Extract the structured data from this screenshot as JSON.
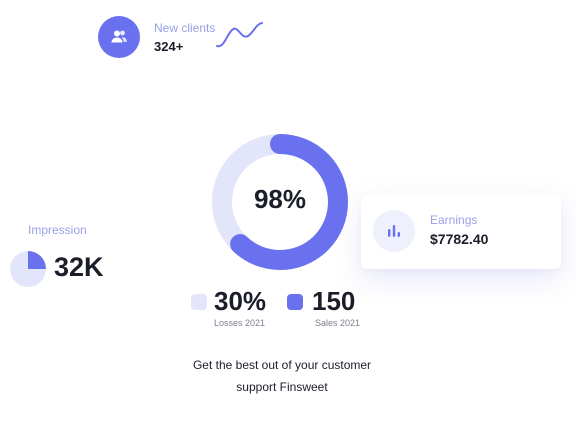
{
  "new_clients": {
    "label": "New clients",
    "value": "324+",
    "icon": "users-icon"
  },
  "donut": {
    "percent_label": "98%",
    "fill_fraction": 0.62
  },
  "impression": {
    "label": "Impression",
    "value": "32K",
    "pie_fraction": 0.25
  },
  "earnings": {
    "label": "Earnings",
    "value": "$7782.40",
    "icon": "bar-chart-icon"
  },
  "stats": {
    "losses_value": "30%",
    "losses_label": "Losses 2021",
    "sales_value": "150",
    "sales_label": "Sales 2021"
  },
  "tagline": {
    "line1": "Get the best out of your customer",
    "line2": "support Finsweet"
  },
  "colors": {
    "accent": "#6a71ee",
    "light_accent": "#e3e5fb",
    "muted_label": "#9a9fe8",
    "text": "#1b1d29"
  }
}
